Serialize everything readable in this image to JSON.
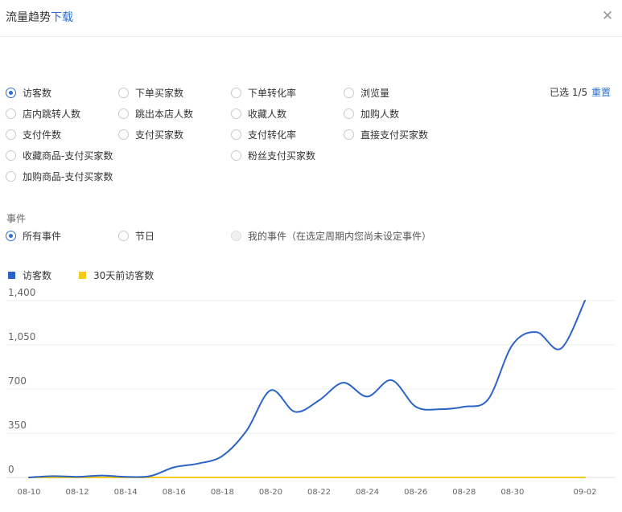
{
  "header": {
    "title": "流量趋势",
    "download": "下载",
    "close_icon": "close-icon"
  },
  "metrics": [
    {
      "label": "访客数",
      "checked": true
    },
    {
      "label": "下单买家数",
      "checked": false
    },
    {
      "label": "下单转化率",
      "checked": false
    },
    {
      "label": "浏览量",
      "checked": false
    },
    {
      "label": "店内跳转人数",
      "checked": false
    },
    {
      "label": "跳出本店人数",
      "checked": false
    },
    {
      "label": "收藏人数",
      "checked": false
    },
    {
      "label": "加购人数",
      "checked": false
    },
    {
      "label": "支付件数",
      "checked": false
    },
    {
      "label": "支付买家数",
      "checked": false
    },
    {
      "label": "支付转化率",
      "checked": false
    },
    {
      "label": "直接支付买家数",
      "checked": false
    },
    {
      "label": "收藏商品-支付买家数",
      "checked": false
    },
    {
      "label": "粉丝支付买家数",
      "checked": false
    },
    {
      "label": "加购商品-支付买家数",
      "checked": false
    }
  ],
  "selection": {
    "info": "已选 1/5",
    "reset": "重置"
  },
  "events": {
    "title": "事件",
    "options": [
      {
        "label": "所有事件",
        "checked": true,
        "disabled": false
      },
      {
        "label": "节日",
        "checked": false,
        "disabled": false
      },
      {
        "label": "我的事件（在选定周期内您尚未设定事件）",
        "checked": false,
        "disabled": true
      }
    ]
  },
  "colors": {
    "accent": "#2c6fd1",
    "series_current": "#2b64c6",
    "series_prev": "#f2cb1d",
    "grid": "#ececec"
  },
  "chart_data": {
    "type": "line",
    "x": [
      "08-10",
      "08-11",
      "08-12",
      "08-13",
      "08-14",
      "08-15",
      "08-16",
      "08-17",
      "08-18",
      "08-19",
      "08-20",
      "08-21",
      "08-22",
      "08-23",
      "08-24",
      "08-25",
      "08-26",
      "08-27",
      "08-28",
      "08-29",
      "08-30",
      "08-31",
      "09-01",
      "09-02"
    ],
    "x_tick_labels": [
      "08-10",
      "08-12",
      "08-14",
      "08-16",
      "08-18",
      "08-20",
      "08-22",
      "08-24",
      "08-26",
      "08-28",
      "08-30",
      "09-02"
    ],
    "series": [
      {
        "name": "访客数",
        "color": "#2b64c6",
        "values": [
          0,
          10,
          5,
          15,
          5,
          10,
          80,
          110,
          170,
          370,
          690,
          520,
          610,
          750,
          640,
          770,
          560,
          540,
          560,
          620,
          1050,
          1150,
          1020,
          1400
        ]
      },
      {
        "name": "30天前访客数",
        "color": "#f2cb1d",
        "values": [
          0,
          0,
          0,
          0,
          0,
          0,
          0,
          0,
          0,
          0,
          0,
          0,
          0,
          0,
          0,
          0,
          0,
          0,
          0,
          0,
          0,
          0,
          0,
          0
        ]
      }
    ],
    "y_ticks": [
      0,
      350,
      700,
      1050,
      1400
    ],
    "y_tick_labels": [
      "0",
      "350",
      "700",
      "1,050",
      "1,400"
    ],
    "ylim": [
      0,
      1400
    ],
    "grid": true,
    "legend": "top-left"
  }
}
